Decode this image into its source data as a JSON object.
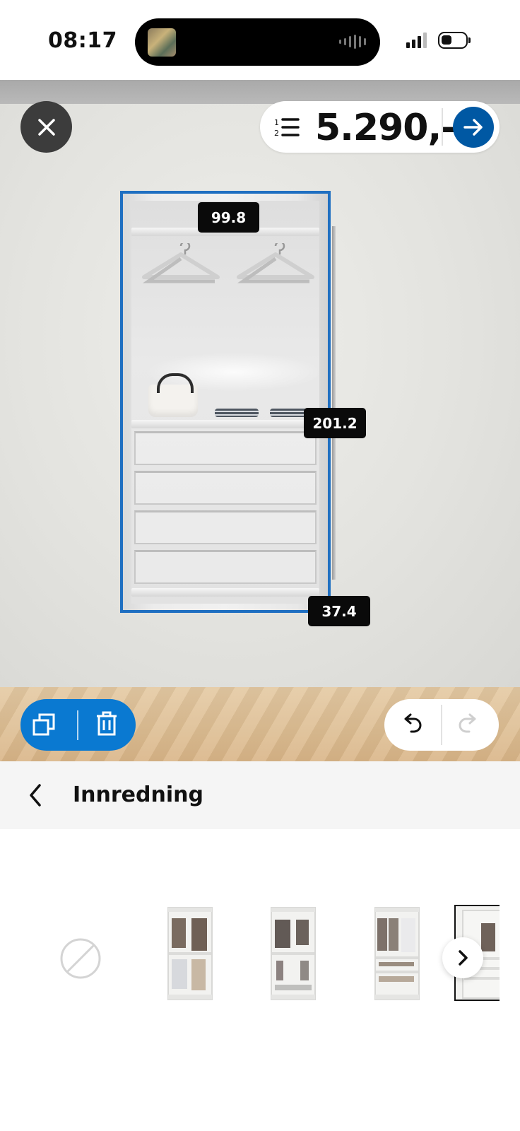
{
  "status_bar": {
    "time": "08:17"
  },
  "toolbar": {
    "price": "5.290,-",
    "close_icon": "close-icon",
    "list_icon": "numbered-list-icon",
    "next_icon": "arrow-right-icon"
  },
  "dimensions": {
    "width": "99.8",
    "height": "201.2",
    "depth": "37.4"
  },
  "actions": {
    "duplicate_icon": "duplicate-icon",
    "delete_icon": "trash-icon",
    "undo_icon": "undo-icon",
    "redo_icon": "redo-icon"
  },
  "category": {
    "title": "Innredning",
    "back_icon": "chevron-left-icon"
  },
  "options": {
    "none_icon": "none-icon",
    "scroll_icon": "chevron-right-icon"
  },
  "colors": {
    "accent": "#0058a3",
    "selection": "#1f6fc1",
    "edit_pill": "#0a79d1"
  }
}
